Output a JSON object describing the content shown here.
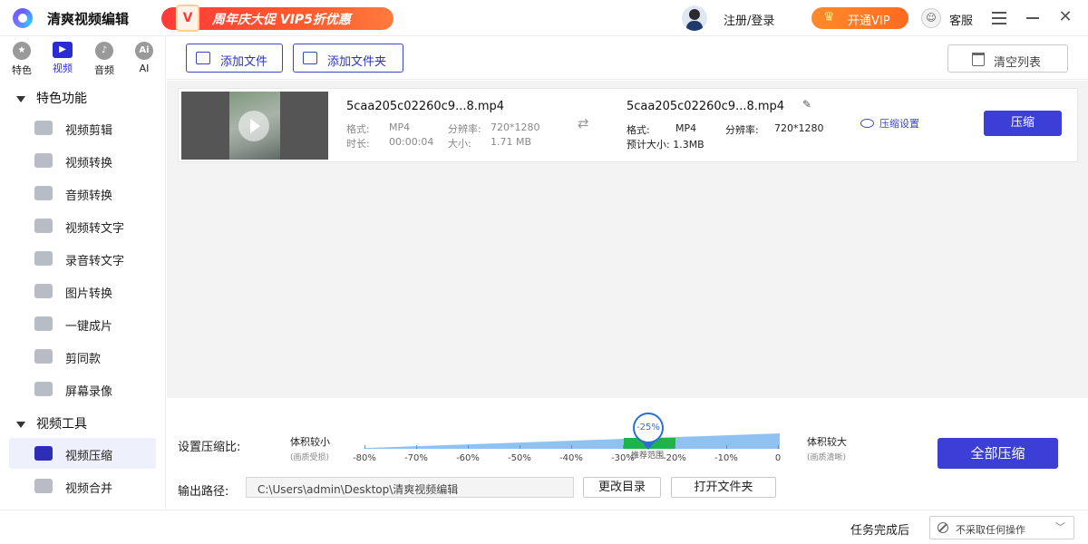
{
  "app": {
    "title": "清爽视频编辑",
    "promo": "周年庆大促 VIP5折优惠",
    "promo_badge": "V",
    "login": "注册/登录",
    "vip_button": "开通VIP",
    "service": "客服"
  },
  "sidebar": {
    "categories": [
      {
        "label": "特色",
        "icon": "star-icon",
        "glyph": "★"
      },
      {
        "label": "视频",
        "icon": "video-icon",
        "glyph": "▶"
      },
      {
        "label": "音频",
        "icon": "music-icon",
        "glyph": "♪"
      },
      {
        "label": "AI",
        "icon": "ai-icon",
        "glyph": "Ai"
      }
    ],
    "active_category": "视频",
    "sections": [
      {
        "label": "特色功能"
      },
      {
        "label": "视频工具"
      }
    ],
    "items": [
      {
        "label": "视频剪辑"
      },
      {
        "label": "视频转换"
      },
      {
        "label": "音频转换"
      },
      {
        "label": "视频转文字"
      },
      {
        "label": "录音转文字"
      },
      {
        "label": "图片转换"
      },
      {
        "label": "一键成片"
      },
      {
        "label": "剪同款"
      },
      {
        "label": "屏幕录像"
      },
      {
        "label": "视频压缩"
      },
      {
        "label": "视频合并"
      }
    ],
    "active_item": "视频压缩"
  },
  "toolbar": {
    "add_file": "添加文件",
    "add_folder": "添加文件夹",
    "clear_list": "清空列表"
  },
  "file": {
    "src_name": "5caa205c02260c9...8.mp4",
    "format_label": "格式:",
    "format": "MP4",
    "resolution_label": "分辨率:",
    "resolution": "720*1280",
    "duration_label": "时长:",
    "duration": "00:00:04",
    "size_label": "大小:",
    "size": "1.71 MB",
    "out_name": "5caa205c02260c9...8.mp4",
    "out_format_label": "格式:",
    "out_format": "MP4",
    "out_resolution_label": "分辨率:",
    "out_resolution": "720*1280",
    "estimated": "预计大小: 1.3MB",
    "settings": "压缩设置",
    "compress": "压缩"
  },
  "panel": {
    "ratio_label": "设置压缩比:",
    "small_size": "体积较小",
    "small_note": "(画质受损)",
    "large_size": "体积较大",
    "large_note": "(画质清晰)",
    "marker": "-25%",
    "recommended": "推荐范围",
    "ticks": [
      "-80%",
      "-70%",
      "-60%",
      "-50%",
      "-40%",
      "-30%",
      "-20%",
      "-10%",
      "0"
    ],
    "compression_value": -25,
    "output_label": "输出路径:",
    "output_path": "C:\\Users\\admin\\Desktop\\清爽视频编辑",
    "change_dir": "更改目录",
    "open_folder": "打开文件夹",
    "compress_all": "全部压缩"
  },
  "status": {
    "after_label": "任务完成后",
    "after_value": "不采取任何操作"
  },
  "colors": {
    "accent": "#3b3fd6",
    "promo": "#ff3a3a",
    "vip": "#ff7a23",
    "recommended": "#20b24b",
    "slider": "#8fc1f3"
  }
}
